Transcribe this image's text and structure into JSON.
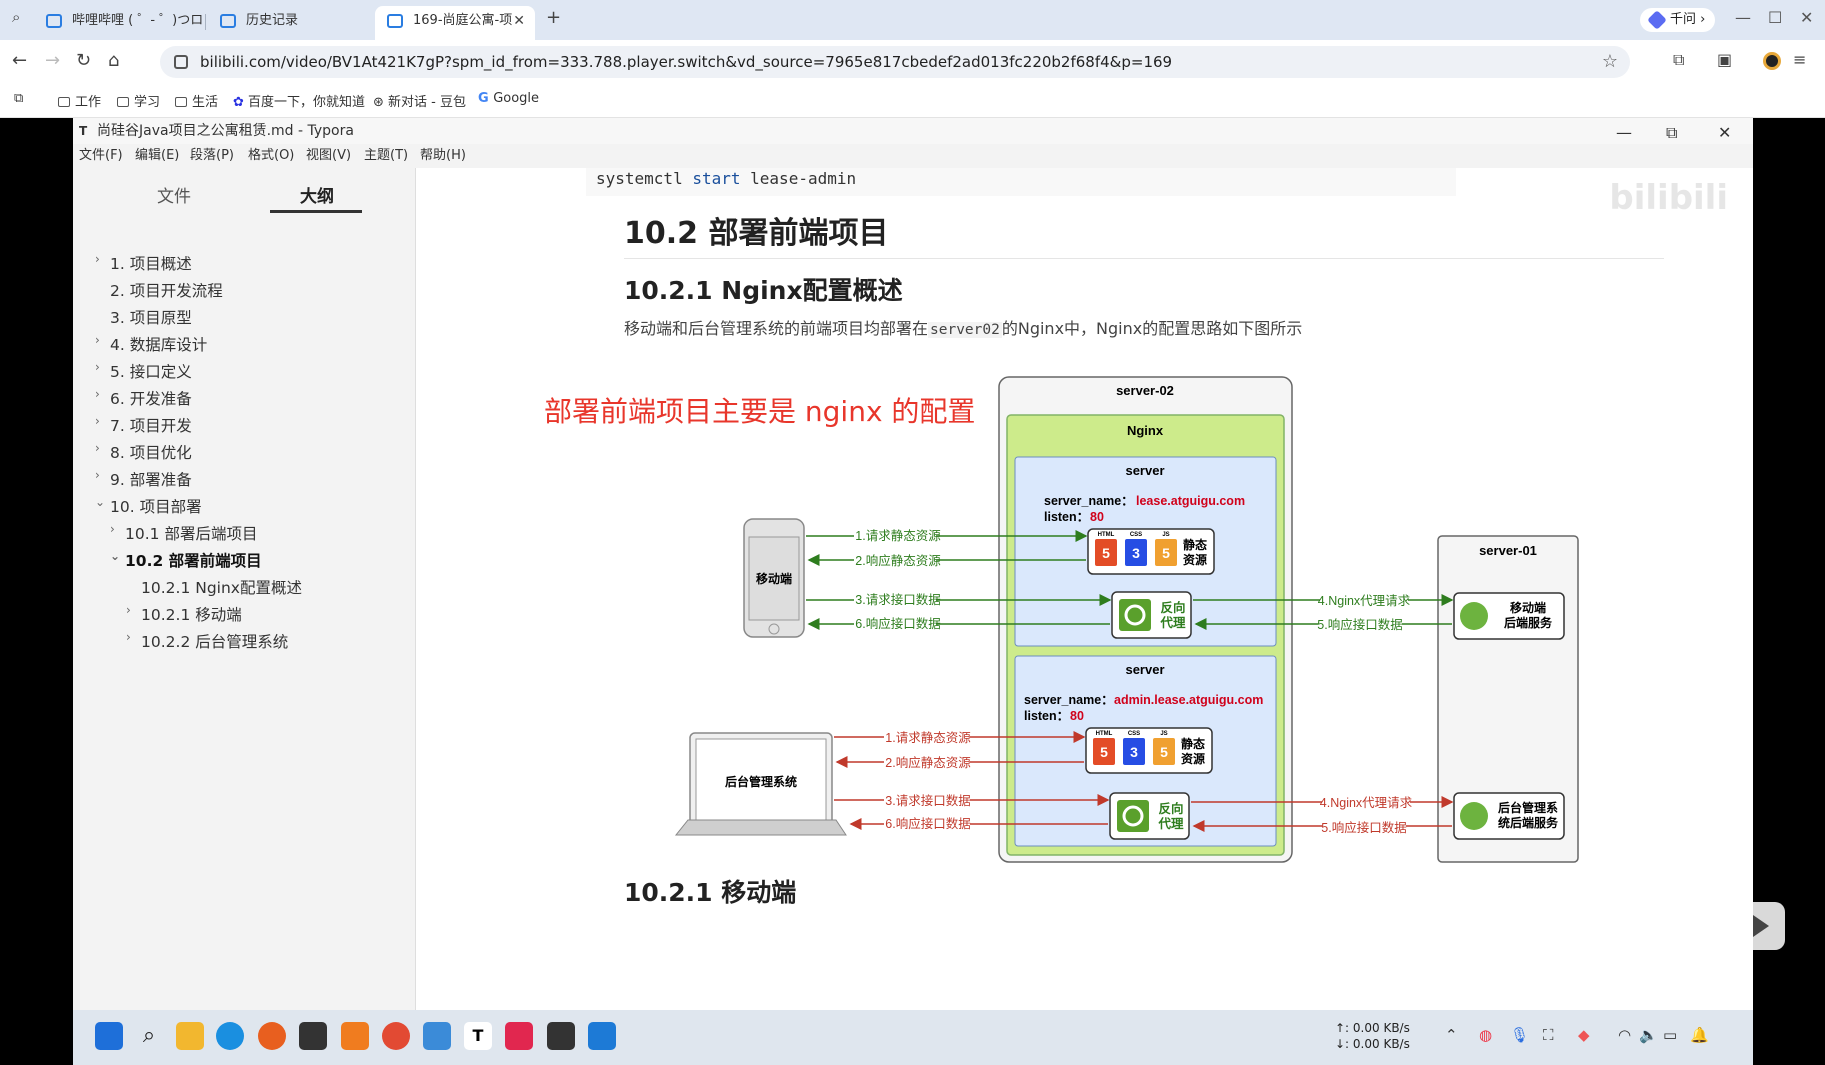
{
  "browser": {
    "tabs": [
      {
        "label": "哔哩哔哩 ( ゜- ゜)つロ"
      },
      {
        "label": "历史记录"
      },
      {
        "label": "169-尚庭公寓-项"
      }
    ],
    "ai_button": "千问",
    "url": "bilibili.com/video/BV1At421K7gP?spm_id_from=333.788.player.switch&vd_source=7965e817cbedef2ad013fc220b2f68f4&p=169",
    "bookmarks": [
      "工作",
      "学习",
      "生活",
      "百度一下，你就知道",
      "新对话 - 豆包",
      "Google"
    ]
  },
  "typora": {
    "title": "尚硅谷Java项目之公寓租赁.md - Typora",
    "menu": [
      "文件(F)",
      "编辑(E)",
      "段落(P)",
      "格式(O)",
      "视图(V)",
      "主题(T)",
      "帮助(H)"
    ],
    "sidebar_tabs": [
      "文件",
      "大纲"
    ],
    "outline": [
      {
        "label": "1. 项目概述"
      },
      {
        "label": "2. 项目开发流程"
      },
      {
        "label": "3. 项目原型"
      },
      {
        "label": "4. 数据库设计"
      },
      {
        "label": "5. 接口定义"
      },
      {
        "label": "6. 开发准备"
      },
      {
        "label": "7. 项目开发"
      },
      {
        "label": "8. 项目优化"
      },
      {
        "label": "9. 部署准备"
      },
      {
        "label": "10. 项目部署"
      },
      {
        "label": "10.1 部署后端项目"
      },
      {
        "label": "10.2 部署前端项目"
      },
      {
        "label": "10.2.1 Nginx配置概述"
      },
      {
        "label": "10.2.1 移动端"
      },
      {
        "label": "10.2.2 后台管理系统"
      }
    ],
    "editor": {
      "code_kw": "systemctl",
      "code_cmd": "start",
      "code_arg": "lease-admin",
      "h2": "10.2 部署前端项目",
      "h3_a": "10.2.1 Nginx配置概述",
      "para_a": "移动端和后台管理系统的前端项目均部署在",
      "para_code": "server02",
      "para_b": "的Nginx中，Nginx的配置思路如下图所示",
      "red_note": "部署前端项目主要是 nginx 的配置",
      "h3_b": "10.2.1 移动端"
    }
  },
  "diagram": {
    "server02": "server-02",
    "nginx": "Nginx",
    "server_label": "server",
    "server1_name_key": "server_name：",
    "server1_name": "lease.atguigu.com",
    "listen_key": "listen：",
    "listen": "80",
    "server2_name": "admin.lease.atguigu.com",
    "static": "静态\n资源",
    "static_1": "静态",
    "static_2": "资源",
    "proxy_1": "反向",
    "proxy_2": "代理",
    "mobile": "移动端",
    "admin": "后台管理系统",
    "server01": "server-01",
    "mobile_backend_1": "移动端",
    "mobile_backend_2": "后端服务",
    "admin_backend_1": "后台管理系",
    "admin_backend_2": "统后端服务",
    "a1": "1.请求静态资源",
    "a2": "2.响应静态资源",
    "a3": "3.请求接口数据",
    "a6": "6.响应接口数据",
    "a4": "4.Nginx代理请求",
    "a5": "5.响应接口数据",
    "html": "HTML",
    "css": "CSS",
    "js": "JS",
    "colors": {
      "green": "#2e7d1e",
      "red": "#c0392b",
      "nginx_bg": "#cdeb8b",
      "server_bg": "#dae8fc"
    }
  },
  "taskbar": {
    "net_up": "↑: 0.00 KB/s",
    "net_down": "↓: 0.00 KB/s"
  }
}
